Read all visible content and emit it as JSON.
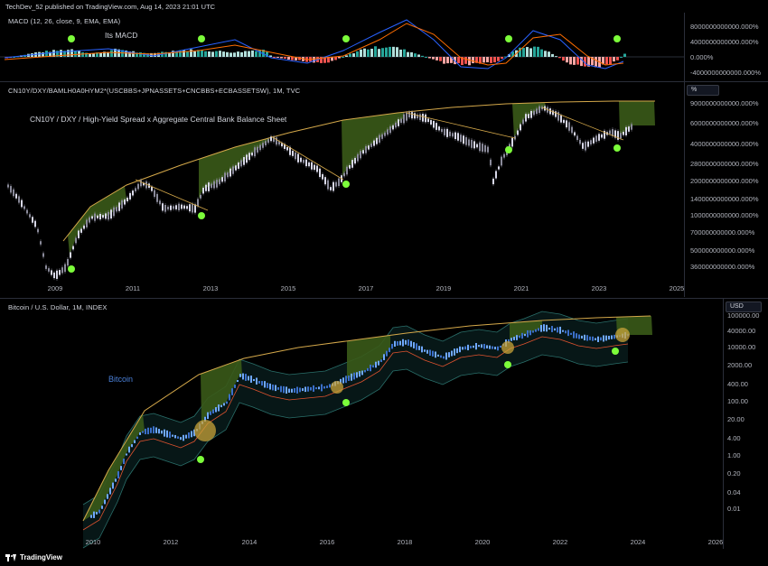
{
  "publisher_line": "TechDev_52 published on TradingView.com, Aug 14, 2023 21:01 UTC",
  "brand": "TradingView",
  "colors": {
    "green_fill": "#3a5a18",
    "curve": "#d4a84a",
    "green_dot": "#7cfc3a",
    "candle": "#d8d8e8"
  },
  "panes": {
    "macd": {
      "title": "MACD (12, 26, close, 9, EMA, EMA)",
      "annotation": "Its MACD",
      "y_labels": [
        "8000000000000.000%",
        "4000000000000.000%",
        "0.000%",
        "-4000000000000.000%"
      ]
    },
    "liquidity": {
      "title": "CN10Y/DXY/BAMLH0A0HYM2*(USCBBS+JPNASSETS+CNCBBS+ECBASSETSW), 1M, TVC",
      "unit": "%",
      "annotation": "CN10Y / DXY / High-Yield Spread    x    Aggregate Central Bank Balance Sheet",
      "y_labels": [
        "9000000000000.000%",
        "6000000000000.000%",
        "4000000000000.000%",
        "2800000000000.000%",
        "2000000000000.000%",
        "1400000000000.000%",
        "1000000000000.000%",
        "700000000000.000%",
        "500000000000.000%",
        "360000000000.000%"
      ],
      "x_labels": [
        "2009",
        "2011",
        "2013",
        "2015",
        "2017",
        "2019",
        "2021",
        "2023",
        "2025"
      ]
    },
    "bitcoin": {
      "title": "Bitcoin / U.S. Dollar, 1M, INDEX",
      "unit": "USD",
      "annotation": "Bitcoin",
      "y_labels": [
        "100000.00",
        "40000.00",
        "10000.00",
        "2000.00",
        "400.00",
        "100.00",
        "20.00",
        "4.00",
        "1.00",
        "0.20",
        "0.04",
        "0.01"
      ],
      "x_labels": [
        "2010",
        "2012",
        "2014",
        "2016",
        "2018",
        "2020",
        "2022",
        "2024",
        "2026"
      ]
    }
  },
  "chart_data": [
    {
      "type": "bar",
      "title": "MACD (12, 26, close, 9, EMA, EMA)",
      "ylim": [
        -5000000000000,
        9000000000000
      ],
      "grid": false,
      "legend": "none"
    },
    {
      "type": "line",
      "title": "CN10Y/DXY/BAMLH0A0HYM2*(USCBBS+JPNASSETS+CNCBBS+ECBASSETSW), 1M, TVC",
      "x_range": [
        "2008",
        "2025"
      ],
      "ylim": [
        300000000000,
        10000000000000
      ],
      "y_scale": "log",
      "grid": false,
      "legend": "none"
    },
    {
      "type": "line",
      "title": "Bitcoin / U.S. Dollar, 1M, INDEX",
      "x_range": [
        "2009",
        "2026"
      ],
      "ylim": [
        0.005,
        150000
      ],
      "y_scale": "log",
      "grid": false,
      "legend": "none"
    }
  ]
}
